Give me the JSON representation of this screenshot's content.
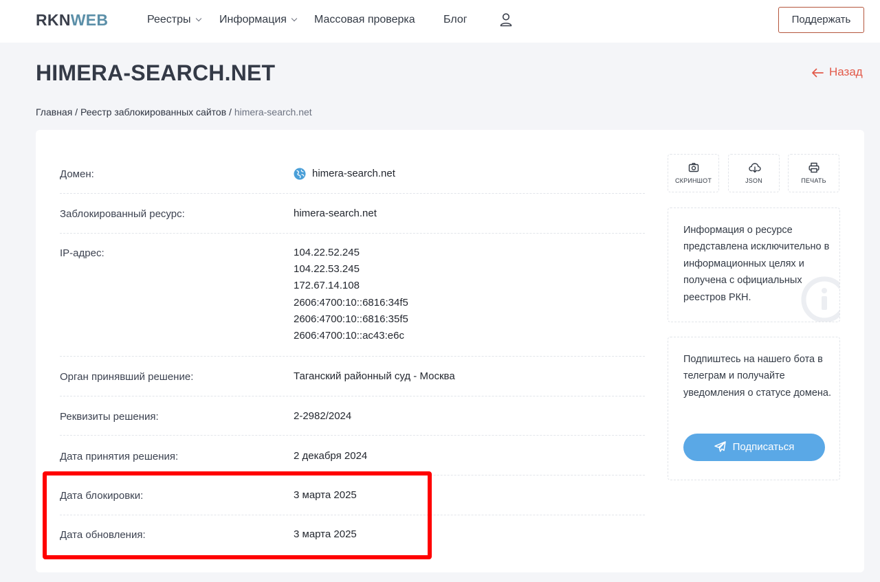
{
  "header": {
    "logo_part1": "RKN",
    "logo_part2": "WEB",
    "nav": [
      {
        "label": "Реестры",
        "dropdown": true
      },
      {
        "label": "Информация",
        "dropdown": true
      },
      {
        "label": "Массовая проверка",
        "dropdown": false
      },
      {
        "label": "Блог",
        "dropdown": false
      }
    ],
    "user_icon": "user-icon",
    "support_label": "Поддержать"
  },
  "page": {
    "title": "HIMERA-SEARCH.NET",
    "back_label": "Назад"
  },
  "breadcrumb": {
    "home": "Главная",
    "separator": " / ",
    "section": "Реестр заблокированных сайтов",
    "current": "himera-search.net"
  },
  "details": {
    "domain_label": "Домен:",
    "domain_value": "himera-search.net",
    "resource_label": "Заблокированный ресурс:",
    "resource_value": "himera-search.net",
    "ip_label": "IP-адрес:",
    "ips": [
      "104.22.52.245",
      "104.22.53.245",
      "172.67.14.108",
      "2606:4700:10::6816:34f5",
      "2606:4700:10::6816:35f5",
      "2606:4700:10::ac43:e6c"
    ],
    "authority_label": "Орган принявший решение:",
    "authority_value": "Таганский районный суд - Москва",
    "requisites_label": "Реквизиты решения:",
    "requisites_value": "2-2982/2024",
    "decision_date_label": "Дата принятия решения:",
    "decision_date_value": "2 декабря 2024",
    "block_date_label": "Дата блокировки:",
    "block_date_value": "3 марта 2025",
    "update_date_label": "Дата обновления:",
    "update_date_value": "3 марта 2025"
  },
  "actions": [
    {
      "label": "СКРИНШОТ",
      "icon": "camera-icon"
    },
    {
      "label": "JSON",
      "icon": "cloud-download-icon"
    },
    {
      "label": "ПЕЧАТЬ",
      "icon": "printer-icon"
    }
  ],
  "info": {
    "text": "Информация о ресурсе представлена исключительно в информационных целях и получена с официальных реестров РКН.",
    "icon": "info-icon"
  },
  "subscribe": {
    "text": "Подпиштесь на нашего бота в телеграм и получайте уведомления о статусе домена.",
    "button_label": "Подписаться",
    "icon": "telegram-icon"
  },
  "colors": {
    "accent_red": "#e25a4a",
    "button_blue": "#5aa8e6",
    "highlight": "#ff0000"
  }
}
